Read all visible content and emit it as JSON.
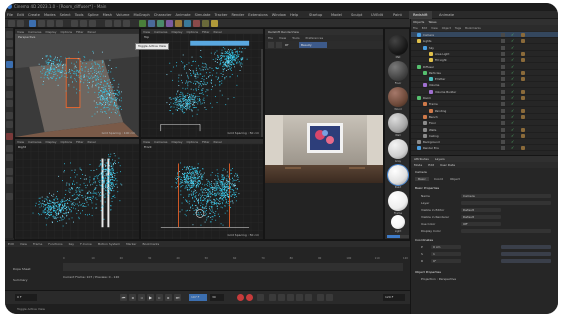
{
  "titlebar": {
    "title": "Cinema 4D 2023.1.0 - [Room_diffuser*] - Main"
  },
  "menubar": {
    "items": [
      "File",
      "Edit",
      "Create",
      "Modes",
      "Select",
      "Tools",
      "Spline",
      "Mesh",
      "Volume",
      "MoGraph",
      "Character",
      "Animate",
      "Simulate",
      "Tracker",
      "Render",
      "Extensions",
      "Window",
      "Help"
    ],
    "layouts": [
      "Startup",
      "Model",
      "Sculpt",
      "UVEdit",
      "Paint",
      "Redshift",
      "Animate"
    ],
    "active_layout": "Redshift"
  },
  "viewports": {
    "perspective": {
      "label": "Perspective",
      "menu": [
        "View",
        "Cameras",
        "Display",
        "Options",
        "Filter",
        "Panel"
      ],
      "grid": "Grid Spacing : 100 cm"
    },
    "top": {
      "label": "Top",
      "menu": [
        "View",
        "Cameras",
        "Display",
        "Options",
        "Filter",
        "Panel"
      ],
      "grid": "Grid Spacing : 50 cm"
    },
    "right": {
      "label": "Right",
      "menu": [
        "View",
        "Cameras",
        "Display",
        "Options",
        "Filter",
        "Panel"
      ],
      "grid": "Grid Spacing : 50 cm"
    },
    "front": {
      "label": "Front",
      "menu": [
        "View",
        "Cameras",
        "Display",
        "Options",
        "Filter",
        "Panel"
      ],
      "grid": "Grid Spacing : 50 cm"
    }
  },
  "tooltip": "Toggle Active View",
  "render_view": {
    "title": "Redshift RenderView",
    "menu": [
      "File",
      "View",
      "Tools",
      "Preferences"
    ],
    "toolbar": [
      "RT",
      "Beauty"
    ]
  },
  "materials": {
    "items": [
      "Mat",
      "Floor",
      "Wood",
      "Wall",
      "Gray",
      "Paint",
      "Frame",
      "Light"
    ],
    "colors": [
      "#1a1a1a",
      "#454545",
      "#6e4a3a",
      "#a7a7a7",
      "#cfcfcf",
      "#e0e0e0",
      "#eeeeee",
      "#f7f7f7"
    ]
  },
  "objects_panel": {
    "tabs": [
      "Objects",
      "Takes"
    ],
    "menu": [
      "File",
      "Edit",
      "View",
      "Object",
      "Tags",
      "Bookmarks"
    ],
    "rows": [
      {
        "name": "Camera",
        "color": "#4a9ee0"
      },
      {
        "name": "Lights",
        "color": "#e0c04a"
      },
      {
        "name": "Sky",
        "color": "#4a9ee0"
      },
      {
        "name": "Area Light",
        "color": "#e0c04a"
      },
      {
        "name": "Fill Light",
        "color": "#e0c04a"
      },
      {
        "name": "Diffuser",
        "color": "#55c06e"
      },
      {
        "name": "Particles",
        "color": "#55c06e"
      },
      {
        "name": "Emitter",
        "color": "#4ac0c0"
      },
      {
        "name": "Volume",
        "color": "#a070d0"
      },
      {
        "name": "Volume Builder",
        "color": "#a070d0"
      },
      {
        "name": "Room",
        "color": "#55c06e"
      },
      {
        "name": "Frame",
        "color": "#d07a4a"
      },
      {
        "name": "Painting",
        "color": "#d07a4a"
      },
      {
        "name": "Bench",
        "color": "#d07a4a"
      },
      {
        "name": "Floor",
        "color": "#8a8a8a"
      },
      {
        "name": "Walls",
        "color": "#8a8a8a"
      },
      {
        "name": "Ceiling",
        "color": "#8a8a8a"
      },
      {
        "name": "Background",
        "color": "#8a8a8a"
      },
      {
        "name": "Render Env",
        "color": "#4a9ee0"
      }
    ]
  },
  "attributes_panel": {
    "tabs": [
      "Attributes",
      "Layers"
    ],
    "menu": [
      "Mode",
      "Edit",
      "User Data"
    ],
    "object_name": "Camera",
    "subtabs": [
      "Basic",
      "Coord",
      "Object"
    ],
    "section": "Basic Properties",
    "fields": [
      {
        "label": "Name",
        "value": "Camera"
      },
      {
        "label": "Layer",
        "value": ""
      },
      {
        "label": "Visible in Editor",
        "value": "Default"
      },
      {
        "label": "Visible in Renderer",
        "value": "Default"
      },
      {
        "label": "Use Color",
        "value": "Off"
      },
      {
        "label": "Display Color",
        "value": ""
      }
    ],
    "coord_section": "Coordinates",
    "coords": [
      {
        "label": "P",
        "value": "0 cm"
      },
      {
        "label": "S",
        "value": "1"
      },
      {
        "label": "R",
        "value": "0°"
      }
    ],
    "bottom_section": "Object Properties",
    "bottom_field": "Projection : Perspective"
  },
  "timeline": {
    "menu": [
      "Edit",
      "View",
      "Frame",
      "Functions",
      "Key",
      "F-Curve",
      "Motion System",
      "Marker",
      "Bookmarks"
    ],
    "label_top": "Dope Sheet",
    "label_left": "Summary",
    "ticks": [
      "0",
      "10",
      "20",
      "30",
      "40",
      "50",
      "60",
      "70",
      "80",
      "90",
      "100",
      "110",
      "120"
    ],
    "current_frame": "Current Frame: 107 / Preview: 0 - 120"
  },
  "transport": {
    "start": "0 F",
    "end": "120 F",
    "current": "107 F",
    "fps": "30"
  },
  "statusbar": {
    "text": "Toggle Active View"
  }
}
